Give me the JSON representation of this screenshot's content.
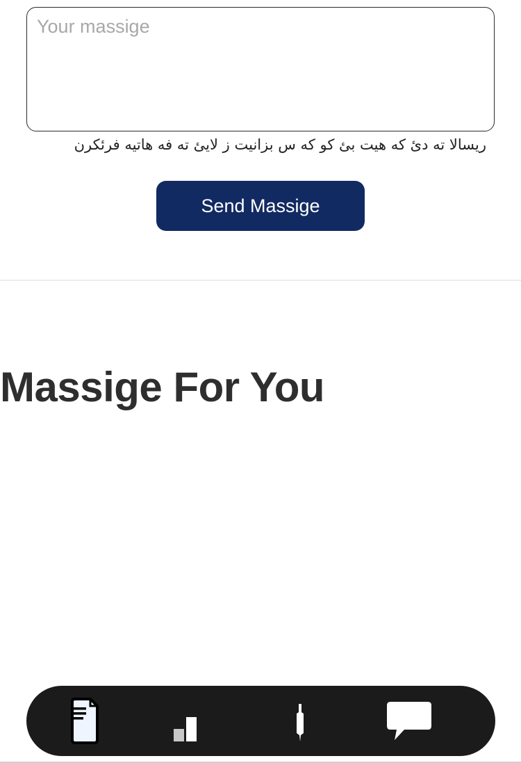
{
  "message_form": {
    "placeholder": "Your massige",
    "value": "",
    "hint": "ریسالا ته دئ که هیت بئ کو که س بزانیت ز لایئ ته فه هاتیه فرئکرن",
    "send_label": "Send Massige"
  },
  "section": {
    "heading": "Massige For You"
  },
  "bottom_nav": {
    "items": [
      {
        "icon": "document-icon",
        "active": true
      },
      {
        "icon": "bar-chart-icon",
        "active": false
      },
      {
        "icon": "pen-icon",
        "active": false
      },
      {
        "icon": "chat-bubble-icon",
        "active": false
      }
    ]
  },
  "colors": {
    "button_background": "#122a62",
    "nav_background": "#1b1b1b",
    "heading_text": "#2e2e2e"
  }
}
